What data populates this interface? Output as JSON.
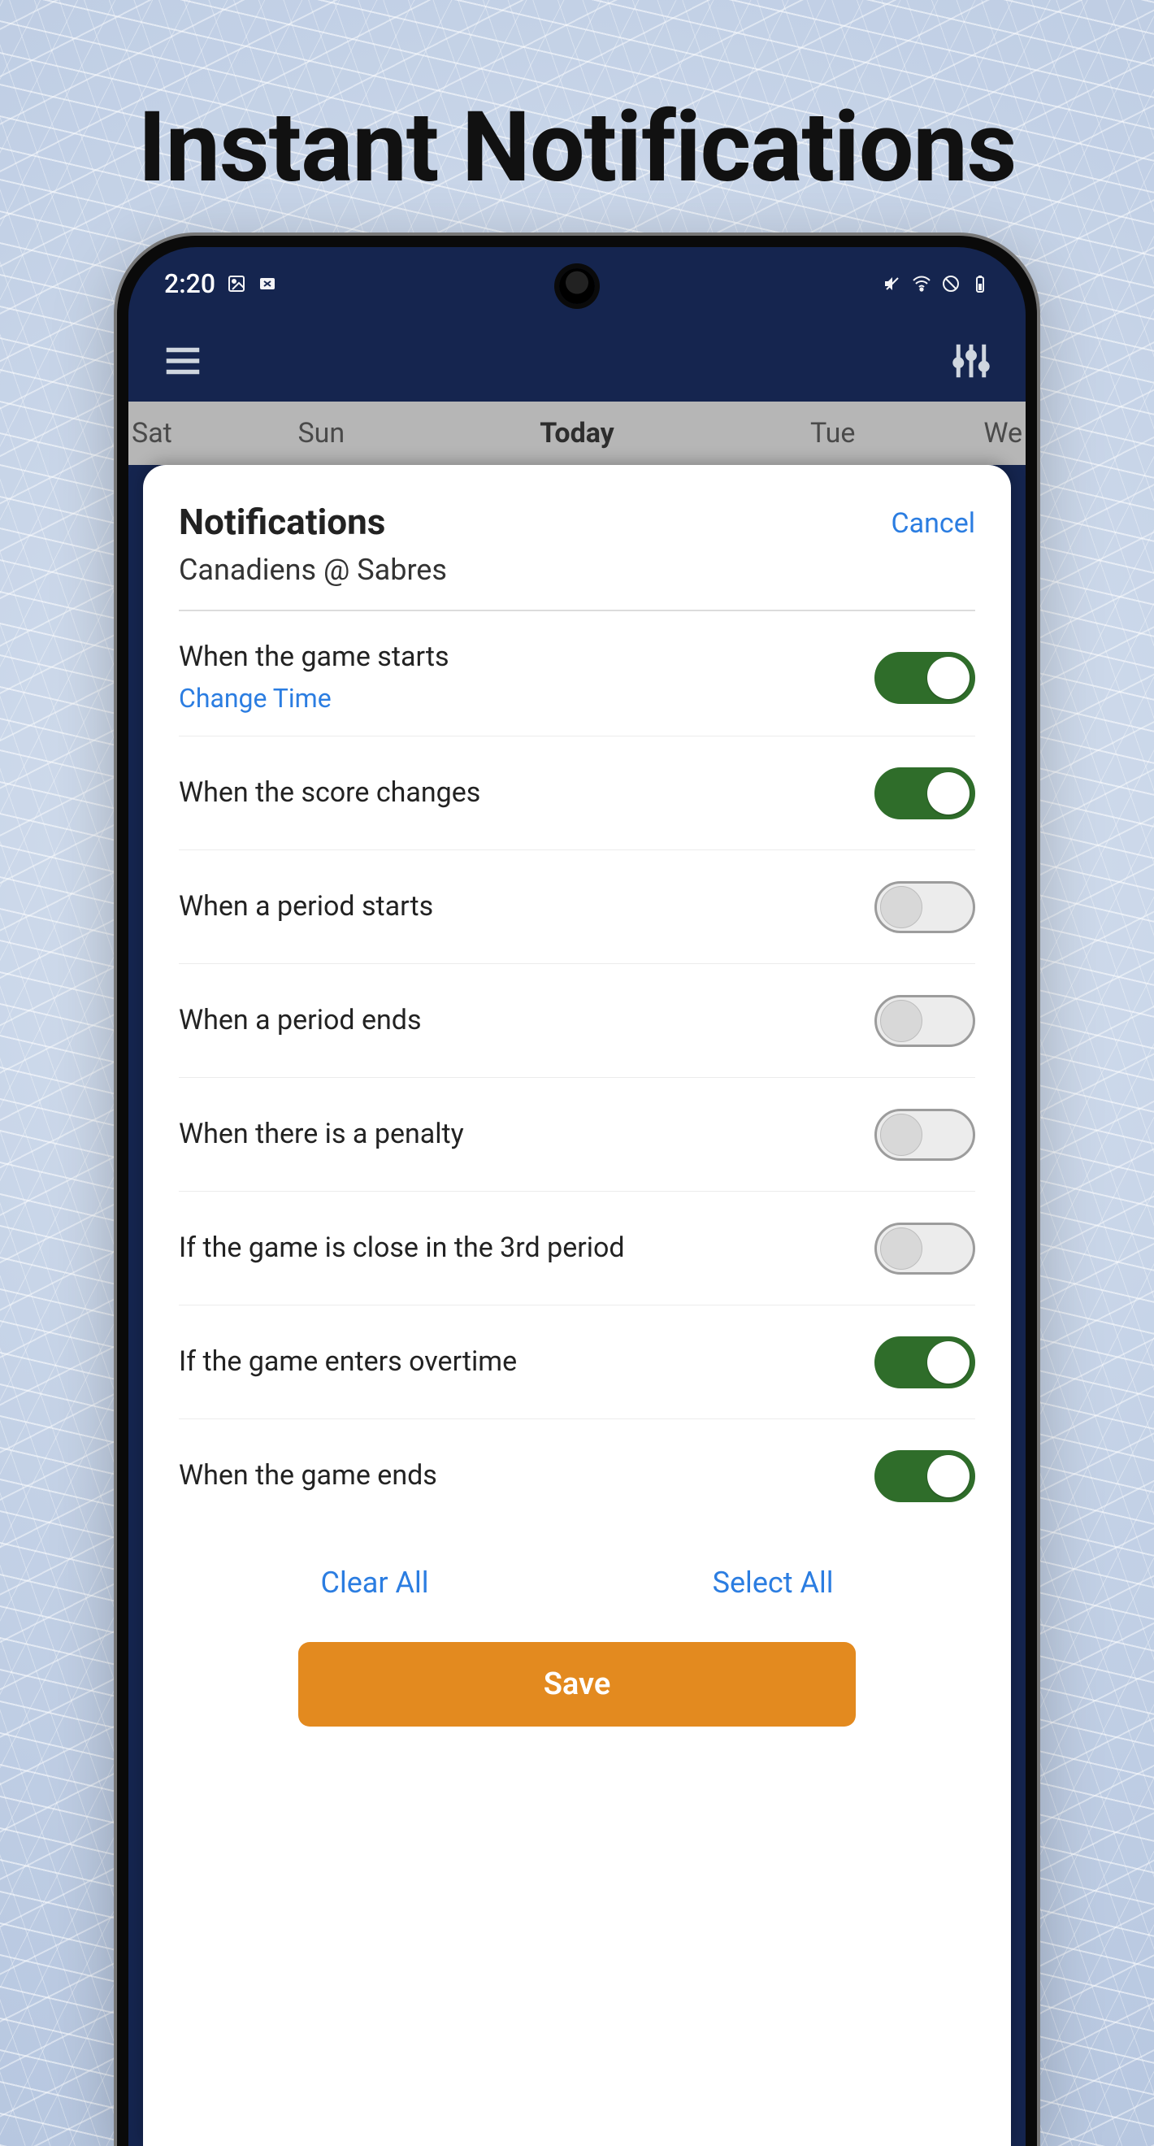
{
  "promo": {
    "title": "Instant Notifications"
  },
  "status": {
    "time": "2:20",
    "icons_left": [
      "image-icon",
      "card-close-icon"
    ],
    "icons_right": [
      "mute-icon",
      "wifi-icon",
      "do-not-disturb-icon",
      "battery-icon"
    ]
  },
  "day_tabs": {
    "items": [
      "Sat",
      "Sun",
      "Today",
      "Tue",
      "We"
    ],
    "active_index": 2
  },
  "sheet": {
    "title": "Notifications",
    "subtitle": "Canadiens @ Sabres",
    "cancel": "Cancel",
    "change_time": "Change Time",
    "options": [
      {
        "label": "When the game starts",
        "on": true,
        "has_sublink": true
      },
      {
        "label": "When the score changes",
        "on": true,
        "has_sublink": false
      },
      {
        "label": "When a period starts",
        "on": false,
        "has_sublink": false
      },
      {
        "label": "When a period ends",
        "on": false,
        "has_sublink": false
      },
      {
        "label": "When there is a penalty",
        "on": false,
        "has_sublink": false
      },
      {
        "label": "If the game is close in the 3rd period",
        "on": false,
        "has_sublink": false
      },
      {
        "label": "If the game enters overtime",
        "on": true,
        "has_sublink": false
      },
      {
        "label": "When the game ends",
        "on": true,
        "has_sublink": false
      }
    ],
    "clear_all": "Clear All",
    "select_all": "Select All",
    "save": "Save"
  }
}
